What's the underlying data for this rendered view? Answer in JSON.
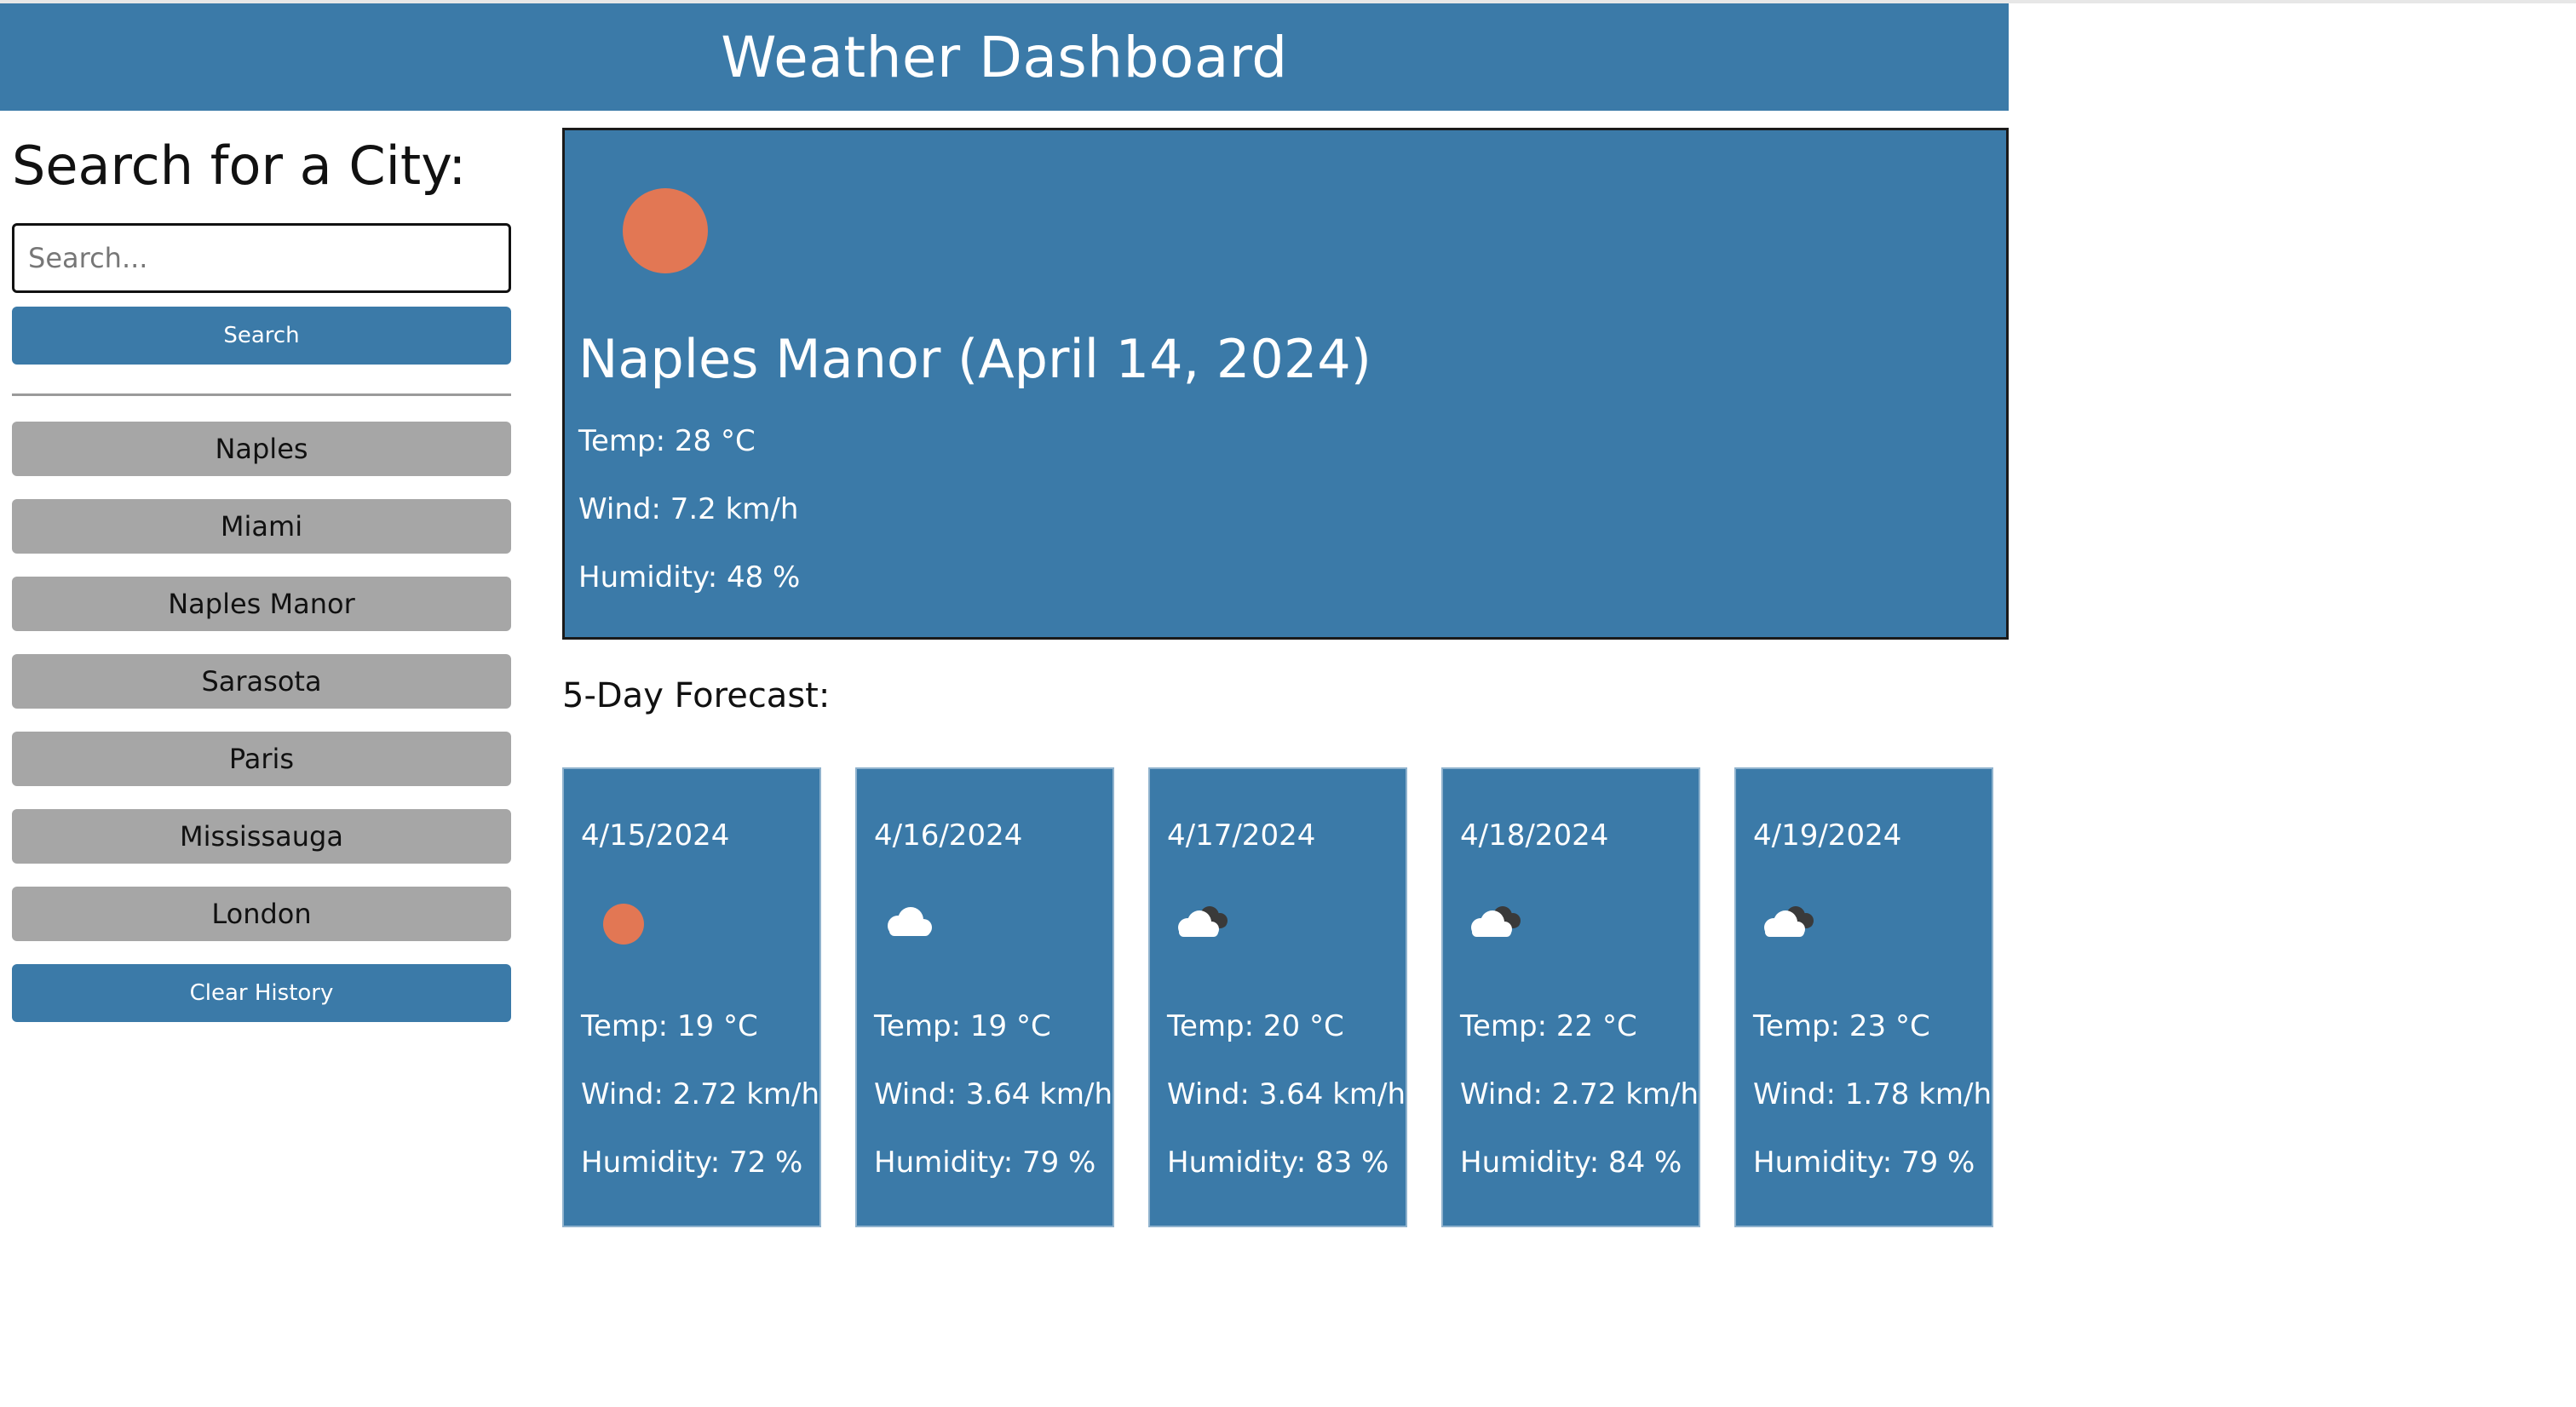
{
  "header": {
    "title": "Weather Dashboard"
  },
  "sidebar": {
    "heading": "Search for a City:",
    "search_placeholder": "Search...",
    "search_button": "Search",
    "history": [
      "Naples",
      "Miami",
      "Naples Manor",
      "Sarasota",
      "Paris",
      "Mississauga",
      "London"
    ],
    "clear_button": "Clear History"
  },
  "current": {
    "title": "Naples Manor (April 14, 2024)",
    "icon": "sun-icon",
    "temp": "Temp: 28 °C",
    "wind": "Wind: 7.2 km/h",
    "humidity": "Humidity: 48 %"
  },
  "forecast": {
    "heading": "5-Day Forecast:",
    "days": [
      {
        "date": "4/15/2024",
        "icon": "sun-icon",
        "temp": "Temp: 19 °C",
        "wind": "Wind: 2.72 km/h",
        "humidity": "Humidity: 72 %"
      },
      {
        "date": "4/16/2024",
        "icon": "cloud-icon",
        "temp": "Temp: 19 °C",
        "wind": "Wind: 3.64 km/h",
        "humidity": "Humidity: 79 %"
      },
      {
        "date": "4/17/2024",
        "icon": "broken-clouds-icon",
        "temp": "Temp: 20 °C",
        "wind": "Wind: 3.64 km/h",
        "humidity": "Humidity: 83 %"
      },
      {
        "date": "4/18/2024",
        "icon": "broken-clouds-icon",
        "temp": "Temp: 22 °C",
        "wind": "Wind: 2.72 km/h",
        "humidity": "Humidity: 84 %"
      },
      {
        "date": "4/19/2024",
        "icon": "broken-clouds-icon",
        "temp": "Temp: 23 °C",
        "wind": "Wind: 1.78 km/h",
        "humidity": "Humidity: 79 %"
      }
    ]
  },
  "colors": {
    "primary": "#3b7aa8",
    "history_button": "#a6a6a6",
    "sun": "#e27754",
    "dark_cloud": "#3a3a3a",
    "cloud": "#ffffff"
  }
}
